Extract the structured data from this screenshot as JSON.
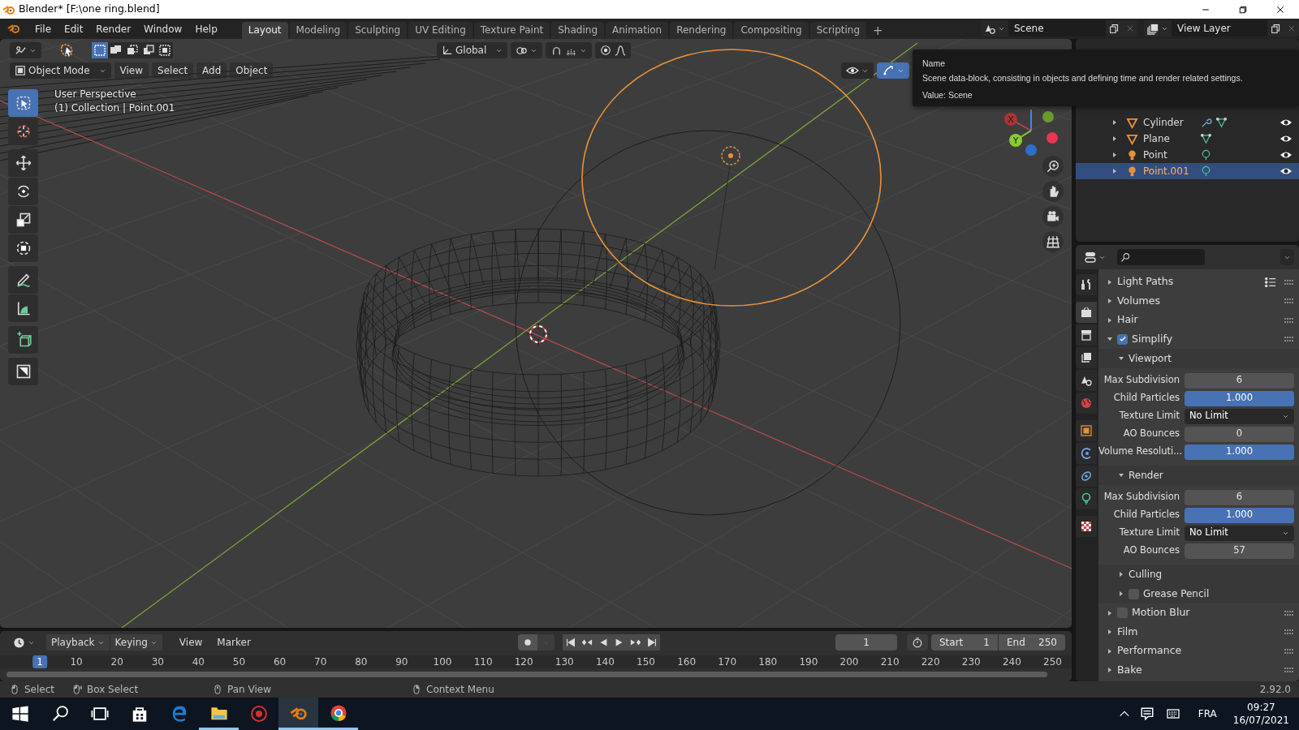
{
  "window": {
    "title": "Blender* [F:\\one ring.blend]"
  },
  "menu": [
    "File",
    "Edit",
    "Render",
    "Window",
    "Help"
  ],
  "workspaces": [
    {
      "label": "Layout",
      "selected": true
    },
    {
      "label": "Modeling",
      "selected": false
    },
    {
      "label": "Sculpting",
      "selected": false
    },
    {
      "label": "UV Editing",
      "selected": false
    },
    {
      "label": "Texture Paint",
      "selected": false
    },
    {
      "label": "Shading",
      "selected": false
    },
    {
      "label": "Animation",
      "selected": false
    },
    {
      "label": "Rendering",
      "selected": false
    },
    {
      "label": "Compositing",
      "selected": false
    },
    {
      "label": "Scripting",
      "selected": false
    }
  ],
  "add_workspace": "+",
  "scene": {
    "value": "Scene"
  },
  "view_layer": {
    "value": "View Layer"
  },
  "viewport": {
    "select_modes": [
      {
        "selected": true
      },
      {
        "selected": false
      },
      {
        "selected": false
      },
      {
        "selected": false
      },
      {
        "selected": false
      }
    ],
    "orientation": "Global",
    "mode": "Object Mode",
    "menus": [
      "View",
      "Select",
      "Add",
      "Object"
    ],
    "toggles": [
      {
        "kind": "visibility",
        "selected": false
      },
      {
        "kind": "gizmo",
        "selected": true
      }
    ],
    "overlay_text": [
      "User Perspective",
      "(1) Collection | Point.001"
    ],
    "tools": [
      {
        "kind": "select",
        "selected": true
      },
      {
        "kind": "cursor",
        "selected": false
      },
      {
        "kind": "move",
        "selected": false
      },
      {
        "kind": "rotate",
        "selected": false
      },
      {
        "kind": "scale",
        "selected": false
      },
      {
        "kind": "transform",
        "selected": false
      },
      {
        "kind": "annotate",
        "selected": false
      },
      {
        "kind": "measure",
        "selected": false
      },
      {
        "kind": "add_cube",
        "selected": false
      },
      {
        "kind": "shade",
        "selected": false
      }
    ],
    "gizmo_labels": [
      "X",
      "Y"
    ],
    "nav_buttons": [
      {
        "kind": "zoom"
      },
      {
        "kind": "pan"
      },
      {
        "kind": "camera"
      },
      {
        "kind": "grid"
      }
    ]
  },
  "tooltip": {
    "title": "Name",
    "description": "Scene data-block, consisting in objects and defining time and render related settings.",
    "value": "Value: Scene"
  },
  "outliner": {
    "items": [
      {
        "name": "Cylinder",
        "kind": "mesh",
        "modifier": true,
        "visible": true,
        "selected": false
      },
      {
        "name": "Plane",
        "kind": "mesh",
        "modifier": false,
        "visible": true,
        "selected": false
      },
      {
        "name": "Point",
        "kind": "light",
        "modifier": false,
        "visible": true,
        "selected": false
      },
      {
        "name": "Point.001",
        "kind": "light",
        "modifier": false,
        "visible": true,
        "selected": true
      }
    ]
  },
  "properties": {
    "tabs": [
      {
        "kind": "tool",
        "selected": false
      },
      {
        "kind": "render",
        "selected": true
      },
      {
        "kind": "output",
        "selected": false
      },
      {
        "kind": "view_layer",
        "selected": false
      },
      {
        "kind": "scene",
        "selected": false
      },
      {
        "kind": "world",
        "selected": false
      },
      {
        "kind": "object",
        "selected": false
      },
      {
        "kind": "physics",
        "selected": false
      },
      {
        "kind": "constraints",
        "selected": false
      },
      {
        "kind": "light_data",
        "selected": false
      },
      {
        "kind": "texture",
        "selected": false
      }
    ],
    "panels": [
      {
        "title": "Light Paths",
        "expanded": false,
        "presets": true
      },
      {
        "title": "Volumes",
        "expanded": false
      },
      {
        "title": "Hair",
        "expanded": false
      },
      {
        "title": "Simplify",
        "expanded": true,
        "checked": true,
        "subpanels": [
          {
            "title": "Viewport",
            "expanded": true,
            "fields": [
              {
                "label": "Max Subdivision",
                "kind": "number",
                "value": "6"
              },
              {
                "label": "Child Particles",
                "kind": "slider",
                "value": "1.000",
                "level": 1
              },
              {
                "label": "Texture Limit",
                "kind": "dropdown",
                "value": "No Limit"
              },
              {
                "label": "AO Bounces",
                "kind": "number",
                "value": "0"
              },
              {
                "label": "Volume Resoluti...",
                "kind": "slider",
                "value": "1.000",
                "level": 1
              }
            ]
          },
          {
            "title": "Render",
            "expanded": true,
            "fields": [
              {
                "label": "Max Subdivision",
                "kind": "number",
                "value": "6"
              },
              {
                "label": "Child Particles",
                "kind": "slider",
                "value": "1.000",
                "level": 1
              },
              {
                "label": "Texture Limit",
                "kind": "dropdown",
                "value": "No Limit"
              },
              {
                "label": "AO Bounces",
                "kind": "number",
                "value": "57"
              }
            ]
          },
          {
            "title": "Culling",
            "expanded": false
          },
          {
            "title": "Grease Pencil",
            "expanded": false,
            "checked": false
          }
        ]
      },
      {
        "title": "Motion Blur",
        "expanded": false,
        "checked": false
      },
      {
        "title": "Film",
        "expanded": false
      },
      {
        "title": "Performance",
        "expanded": false
      },
      {
        "title": "Bake",
        "expanded": false
      }
    ]
  },
  "timeline": {
    "menus": [
      {
        "label": "Playback",
        "dropdown": true
      },
      {
        "label": "Keying",
        "dropdown": true
      },
      {
        "label": "View",
        "dropdown": false
      },
      {
        "label": "Marker",
        "dropdown": false
      }
    ],
    "controls": [
      {
        "kind": "jump_start"
      },
      {
        "kind": "key_prev"
      },
      {
        "kind": "play_reverse"
      },
      {
        "kind": "play"
      },
      {
        "kind": "key_next"
      },
      {
        "kind": "jump_end"
      }
    ],
    "current_frame": "1",
    "start": {
      "label": "Start",
      "value": "1"
    },
    "end": {
      "label": "End",
      "value": "250"
    },
    "ruler": [
      {
        "label": "1",
        "selected": true
      },
      {
        "label": "10",
        "selected": false
      },
      {
        "label": "20",
        "selected": false
      },
      {
        "label": "30",
        "selected": false
      },
      {
        "label": "40",
        "selected": false
      },
      {
        "label": "50",
        "selected": false
      },
      {
        "label": "60",
        "selected": false
      },
      {
        "label": "70",
        "selected": false
      },
      {
        "label": "80",
        "selected": false
      },
      {
        "label": "90",
        "selected": false
      },
      {
        "label": "100",
        "selected": false
      },
      {
        "label": "110",
        "selected": false
      },
      {
        "label": "120",
        "selected": false
      },
      {
        "label": "130",
        "selected": false
      },
      {
        "label": "140",
        "selected": false
      },
      {
        "label": "150",
        "selected": false
      },
      {
        "label": "160",
        "selected": false
      },
      {
        "label": "170",
        "selected": false
      },
      {
        "label": "180",
        "selected": false
      },
      {
        "label": "190",
        "selected": false
      },
      {
        "label": "200",
        "selected": false
      },
      {
        "label": "210",
        "selected": false
      },
      {
        "label": "220",
        "selected": false
      },
      {
        "label": "230",
        "selected": false
      },
      {
        "label": "240",
        "selected": false
      },
      {
        "label": "250",
        "selected": false
      }
    ]
  },
  "status_bar": {
    "hints": [
      {
        "kind": "left",
        "label": "Select"
      },
      {
        "kind": "drag",
        "label": "Box Select"
      },
      {
        "kind": "middle",
        "label": "Pan View"
      },
      {
        "kind": "right",
        "label": "Context Menu"
      }
    ],
    "version": "2.92.0"
  },
  "taskbar": {
    "apps": [
      {
        "kind": "start",
        "running": false,
        "selected": false
      },
      {
        "kind": "search",
        "running": false,
        "selected": false
      },
      {
        "kind": "task_view",
        "running": false,
        "selected": false
      },
      {
        "kind": "store",
        "running": false,
        "selected": false
      },
      {
        "kind": "edge",
        "running": false,
        "selected": false
      },
      {
        "kind": "explorer",
        "running": true,
        "selected": false
      },
      {
        "kind": "game",
        "running": false,
        "selected": false
      },
      {
        "kind": "blender",
        "running": true,
        "selected": true
      },
      {
        "kind": "chrome",
        "running": true,
        "selected": false
      }
    ],
    "language": "FRA",
    "time": "09:27",
    "date": "16/07/2021"
  }
}
